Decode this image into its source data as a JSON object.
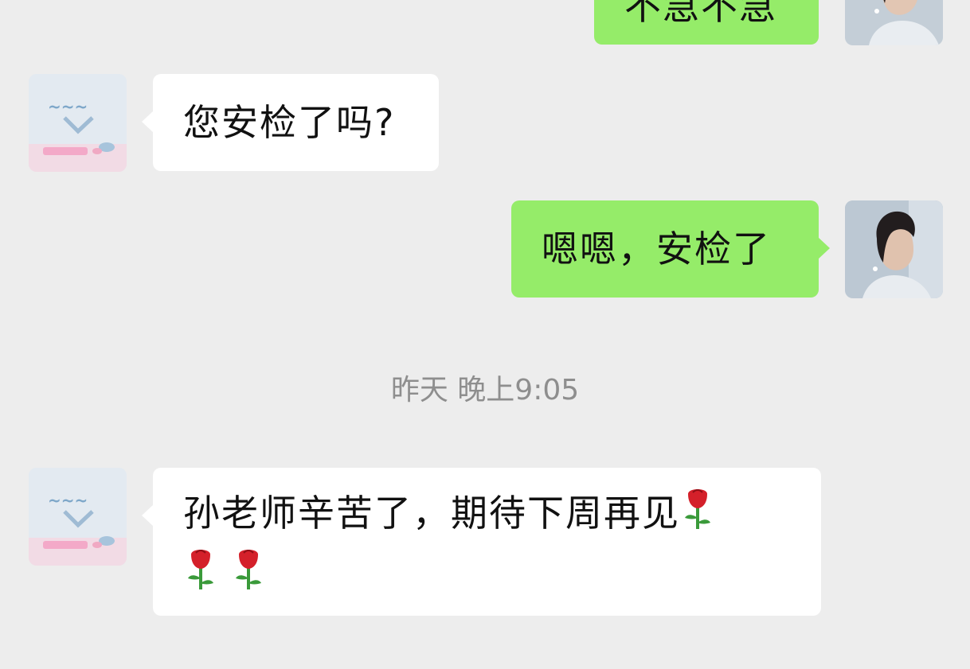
{
  "messages": [
    {
      "side": "right",
      "text": "不急不急"
    },
    {
      "side": "left",
      "text": "您安检了吗?"
    },
    {
      "side": "right",
      "text": "嗯嗯，安检了"
    },
    {
      "side": "left",
      "text": "孙老师辛苦了，期待下周再见"
    }
  ],
  "timestamp": "昨天 晚上9:05",
  "icons": {
    "other_avatar": "sticker-avatar-icon",
    "self_avatar": "profile-photo-avatar",
    "emoji": "rose-emoji-icon"
  },
  "colors": {
    "background": "#ededed",
    "self_bubble": "#95ec69",
    "other_bubble": "#ffffff",
    "timestamp_text": "#8e8e8e"
  }
}
